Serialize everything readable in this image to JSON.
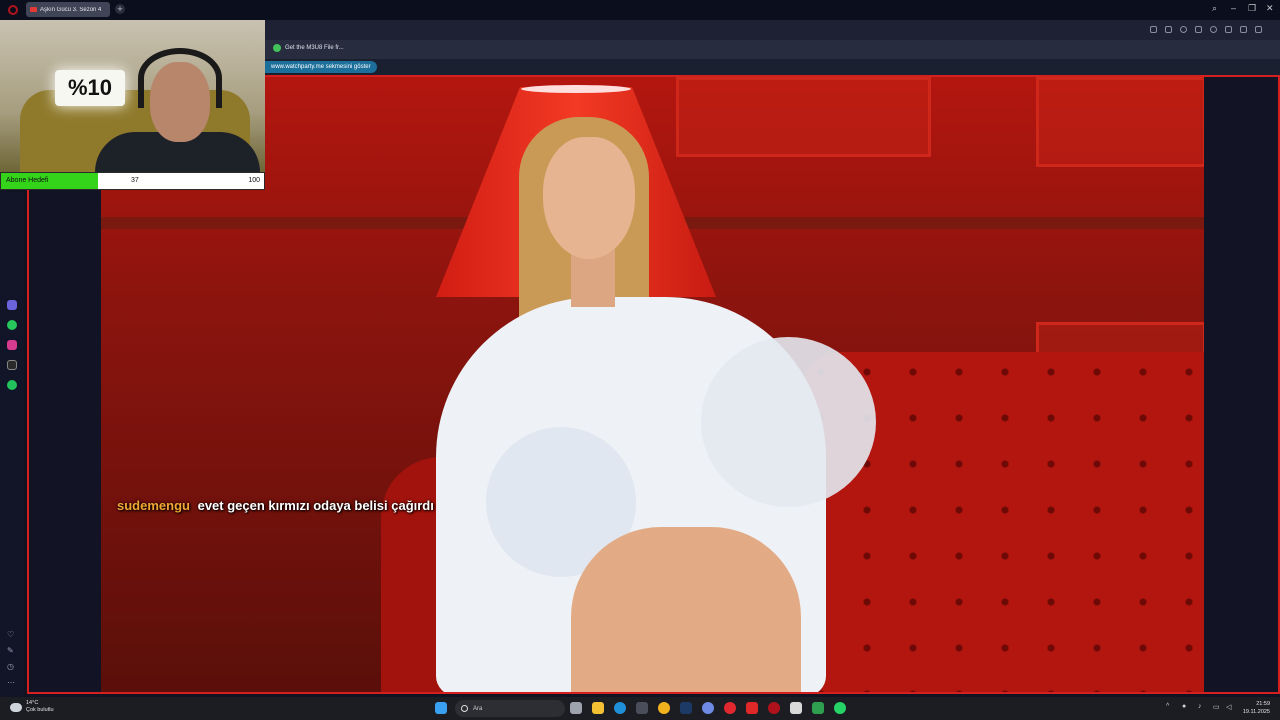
{
  "browser": {
    "tab_title": "Aşkın Gücü 3. Sezon 4",
    "new_tab": "+",
    "bookmark_label": "Get the M3U8 File fr...",
    "infobar_text": "www.watchparty.me sekmesini göster"
  },
  "window_controls": {
    "search": "⌕",
    "minimize": "–",
    "restore": "❐",
    "close": "✕"
  },
  "overlay": {
    "goal_label": "Abone Hedefi",
    "goal_current": "37",
    "goal_max": "100",
    "goal_progress": 0.37,
    "cam_sign": "%10"
  },
  "chat": {
    "username": "sudemengu",
    "message": "evet geçen kırmızı odaya belisi çağırdı"
  },
  "rail": {
    "items": [
      "kick-icon",
      "whatsapp-icon",
      "instagram-icon",
      "x-icon",
      "spotify-icon"
    ],
    "bottom": {
      "heart": "♡",
      "edit": "✎",
      "history": "◷",
      "more": "⋯"
    }
  },
  "taskbar": {
    "weather_temp": "14°C",
    "weather_desc": "Çok bulutlu",
    "search_placeholder": "Ara",
    "time": "21:59",
    "date": "19.11.2025"
  },
  "colors": {
    "accent_red": "#d52020",
    "goal_green": "#34d41a",
    "chat_user": "#f2a735"
  }
}
